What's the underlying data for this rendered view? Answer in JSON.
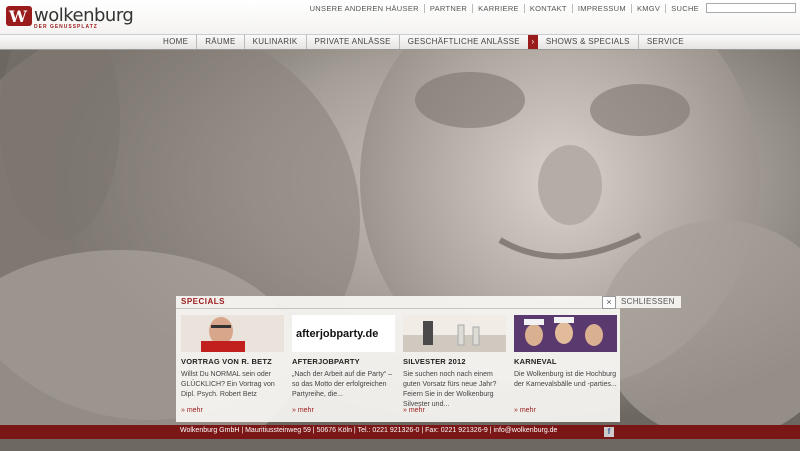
{
  "brand": {
    "name": "wolkenburg",
    "tagline": "DER GENUSSPLATZ"
  },
  "top_nav": [
    "UNSERE ANDEREN HÄUSER",
    "PARTNER",
    "KARRIERE",
    "KONTAKT",
    "IMPRESSUM",
    "KMGV",
    "SUCHE"
  ],
  "search": {
    "placeholder": ""
  },
  "main_nav": {
    "items": [
      "HOME",
      "RÄUME",
      "KULINARIK",
      "PRIVATE ANLÄSSE",
      "GESCHÄFTLICHE ANLÄSSE"
    ],
    "marker": "›",
    "active": "SHOWS & SPECIALS",
    "after": [
      "SERVICE"
    ]
  },
  "specials": {
    "title": "SPECIALS",
    "close_label": "SCHLIESSEN",
    "close_icon": "×",
    "cards": [
      {
        "title": "VORTRAG VON R. BETZ",
        "text": "Willst Du NORMAL sein oder GLÜCKLICH? Ein Vortrag von Dipl. Psych. Robert Betz",
        "more": "» mehr"
      },
      {
        "title": "AFTERJOBPARTY",
        "text": "„Nach der Arbeit auf die Party“ – so das Motto der erfolgreichen Partyreihe, die...",
        "more": "» mehr",
        "logo_text": "afterjobparty.de"
      },
      {
        "title": "SILVESTER 2012",
        "text": "Sie suchen noch nach einem guten Vorsatz fürs neue Jahr? Feiern Sie in der Wolkenburg Silvester und...",
        "more": "» mehr"
      },
      {
        "title": "KARNEVAL",
        "text": "Die Wolkenburg ist die Hochburg der Karnevalsbälle und -parties...",
        "more": "» mehr"
      }
    ]
  },
  "footer": {
    "text": "Wolkenburg GmbH | Mauritiussteinweg 59 | 50676 Köln | Tel.: 0221 921326-0 | Fax: 0221 921326-9 | info@wolkenburg.de",
    "social_icon": "f"
  },
  "colors": {
    "accent": "#9a1b1b",
    "footer": "#7a1616"
  }
}
